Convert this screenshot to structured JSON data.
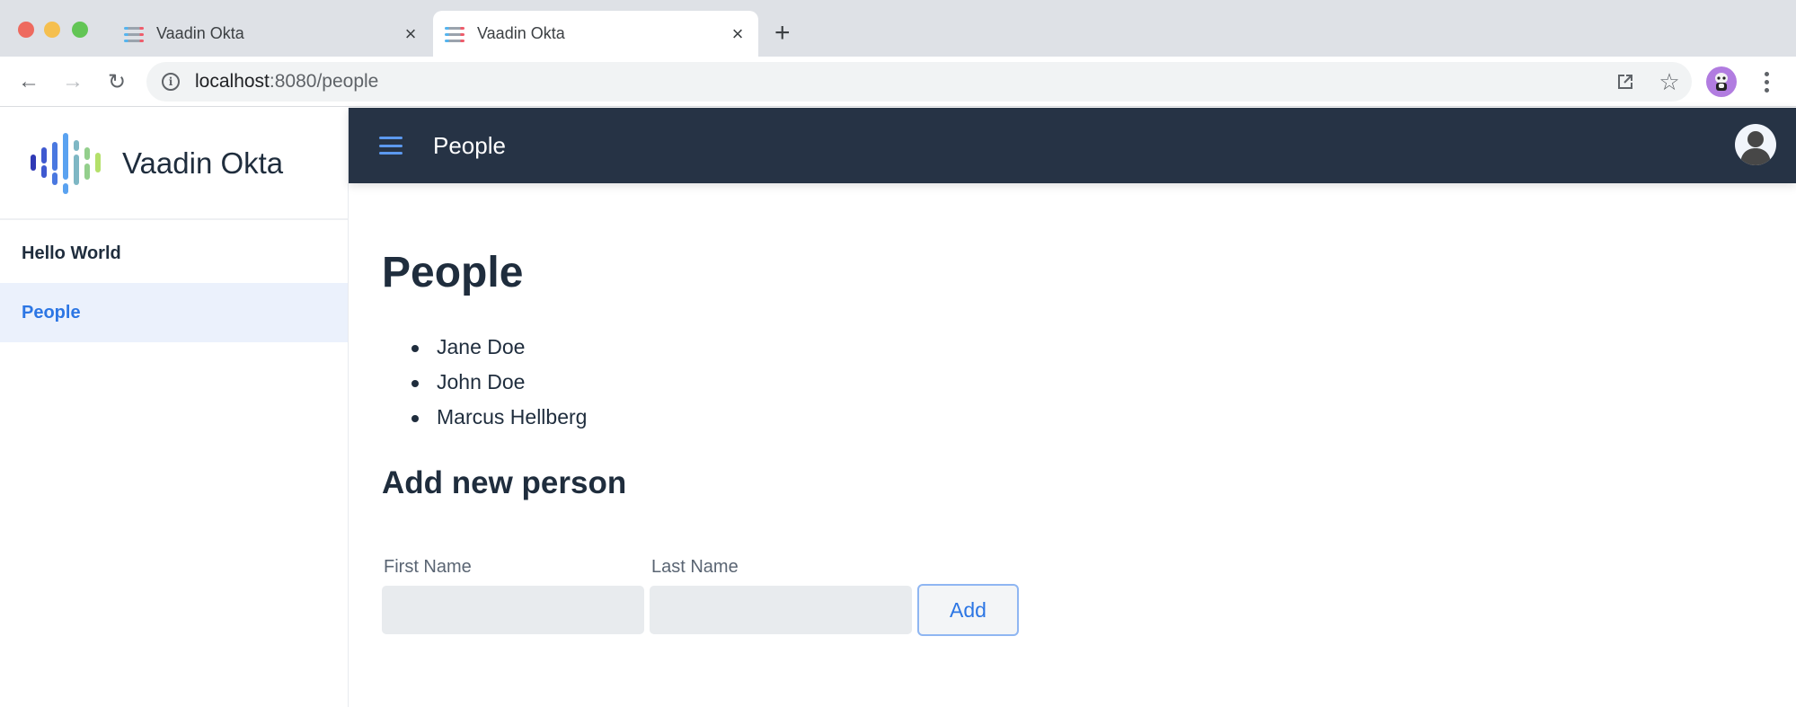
{
  "browser": {
    "tabs": [
      {
        "title": "Vaadin Okta",
        "active": false,
        "favicon": "vaadin-lines-icon",
        "close": "×"
      },
      {
        "title": "Vaadin Okta",
        "active": true,
        "favicon": "vaadin-lines-icon",
        "close": "×"
      }
    ],
    "new_tab": "+",
    "url_host": "localhost",
    "url_rest": ":8080/people",
    "icons": {
      "back": "←",
      "forward": "→",
      "reload": "↻",
      "info": "i",
      "star": "☆"
    }
  },
  "app": {
    "brand_name": "Vaadin Okta",
    "nav": [
      {
        "label": "Hello World",
        "active": false
      },
      {
        "label": "People",
        "active": true
      }
    ],
    "header_title": "People",
    "page_title": "People",
    "people": [
      "Jane Doe",
      "John Doe",
      "Marcus Hellberg"
    ],
    "section_title": "Add new person",
    "form": {
      "first_name_label": "First Name",
      "first_name_value": "",
      "last_name_label": "Last Name",
      "last_name_value": "",
      "add_label": "Add"
    },
    "colors": {
      "header_bg": "#263345",
      "accent": "#2c76e4",
      "active_nav_bg": "#ebf1fc"
    }
  }
}
